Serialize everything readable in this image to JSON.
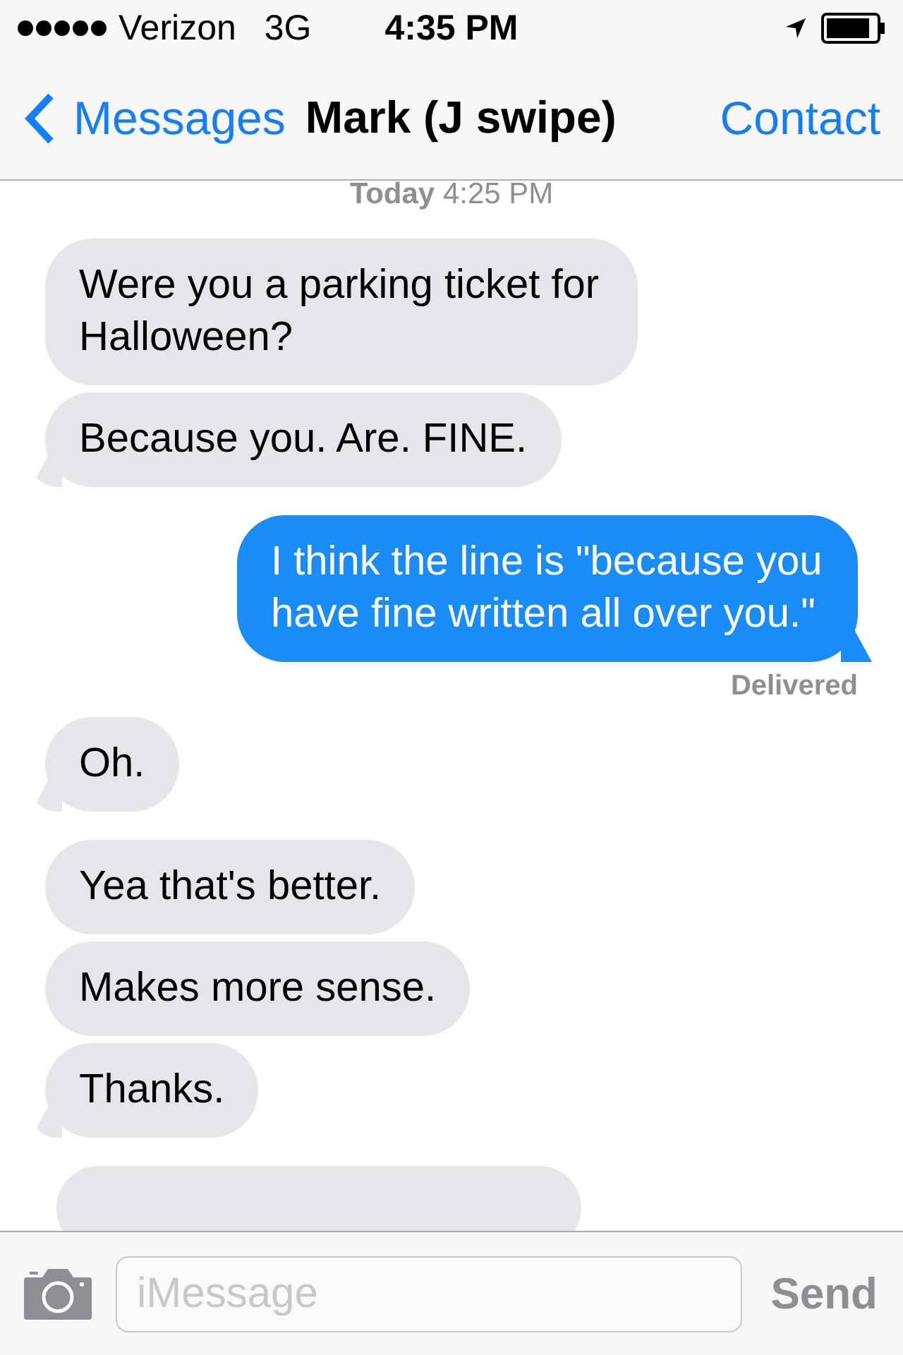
{
  "status_bar": {
    "carrier": "Verizon",
    "network": "3G",
    "time": "4:35 PM"
  },
  "nav_bar": {
    "back": "Messages",
    "title": "Mark (J swipe)",
    "action": "Contact"
  },
  "timestamp": "**Today** 4:25 PM",
  "messages": [
    {
      "kind": "bubble",
      "outgoing": false,
      "text": "Were you a parking ticket for Halloween?",
      "tail": false
    },
    {
      "kind": "bubble",
      "outgoing": false,
      "text": "Because you. Are. FINE.",
      "tail": true
    },
    {
      "kind": "bubble",
      "outgoing": true,
      "text": "I think the line is \"because you have fine written all over you.\"",
      "tail": true,
      "receipt": "Delivered"
    },
    {
      "kind": "bubble",
      "outgoing": false,
      "text": "Oh.",
      "tail": true
    },
    {
      "kind": "bubble",
      "outgoing": false,
      "text": "Yea that's better.",
      "tail": false
    },
    {
      "kind": "bubble",
      "outgoing": false,
      "text": "Makes more sense.",
      "tail": false
    },
    {
      "kind": "bubble",
      "outgoing": false,
      "text": "Thanks.",
      "tail": true
    },
    {
      "kind": "cut_off",
      "outgoing": false
    }
  ],
  "compose": {
    "placeholder": "iMessage",
    "send": {
      "label": "Send",
      "disabled": true
    }
  }
}
